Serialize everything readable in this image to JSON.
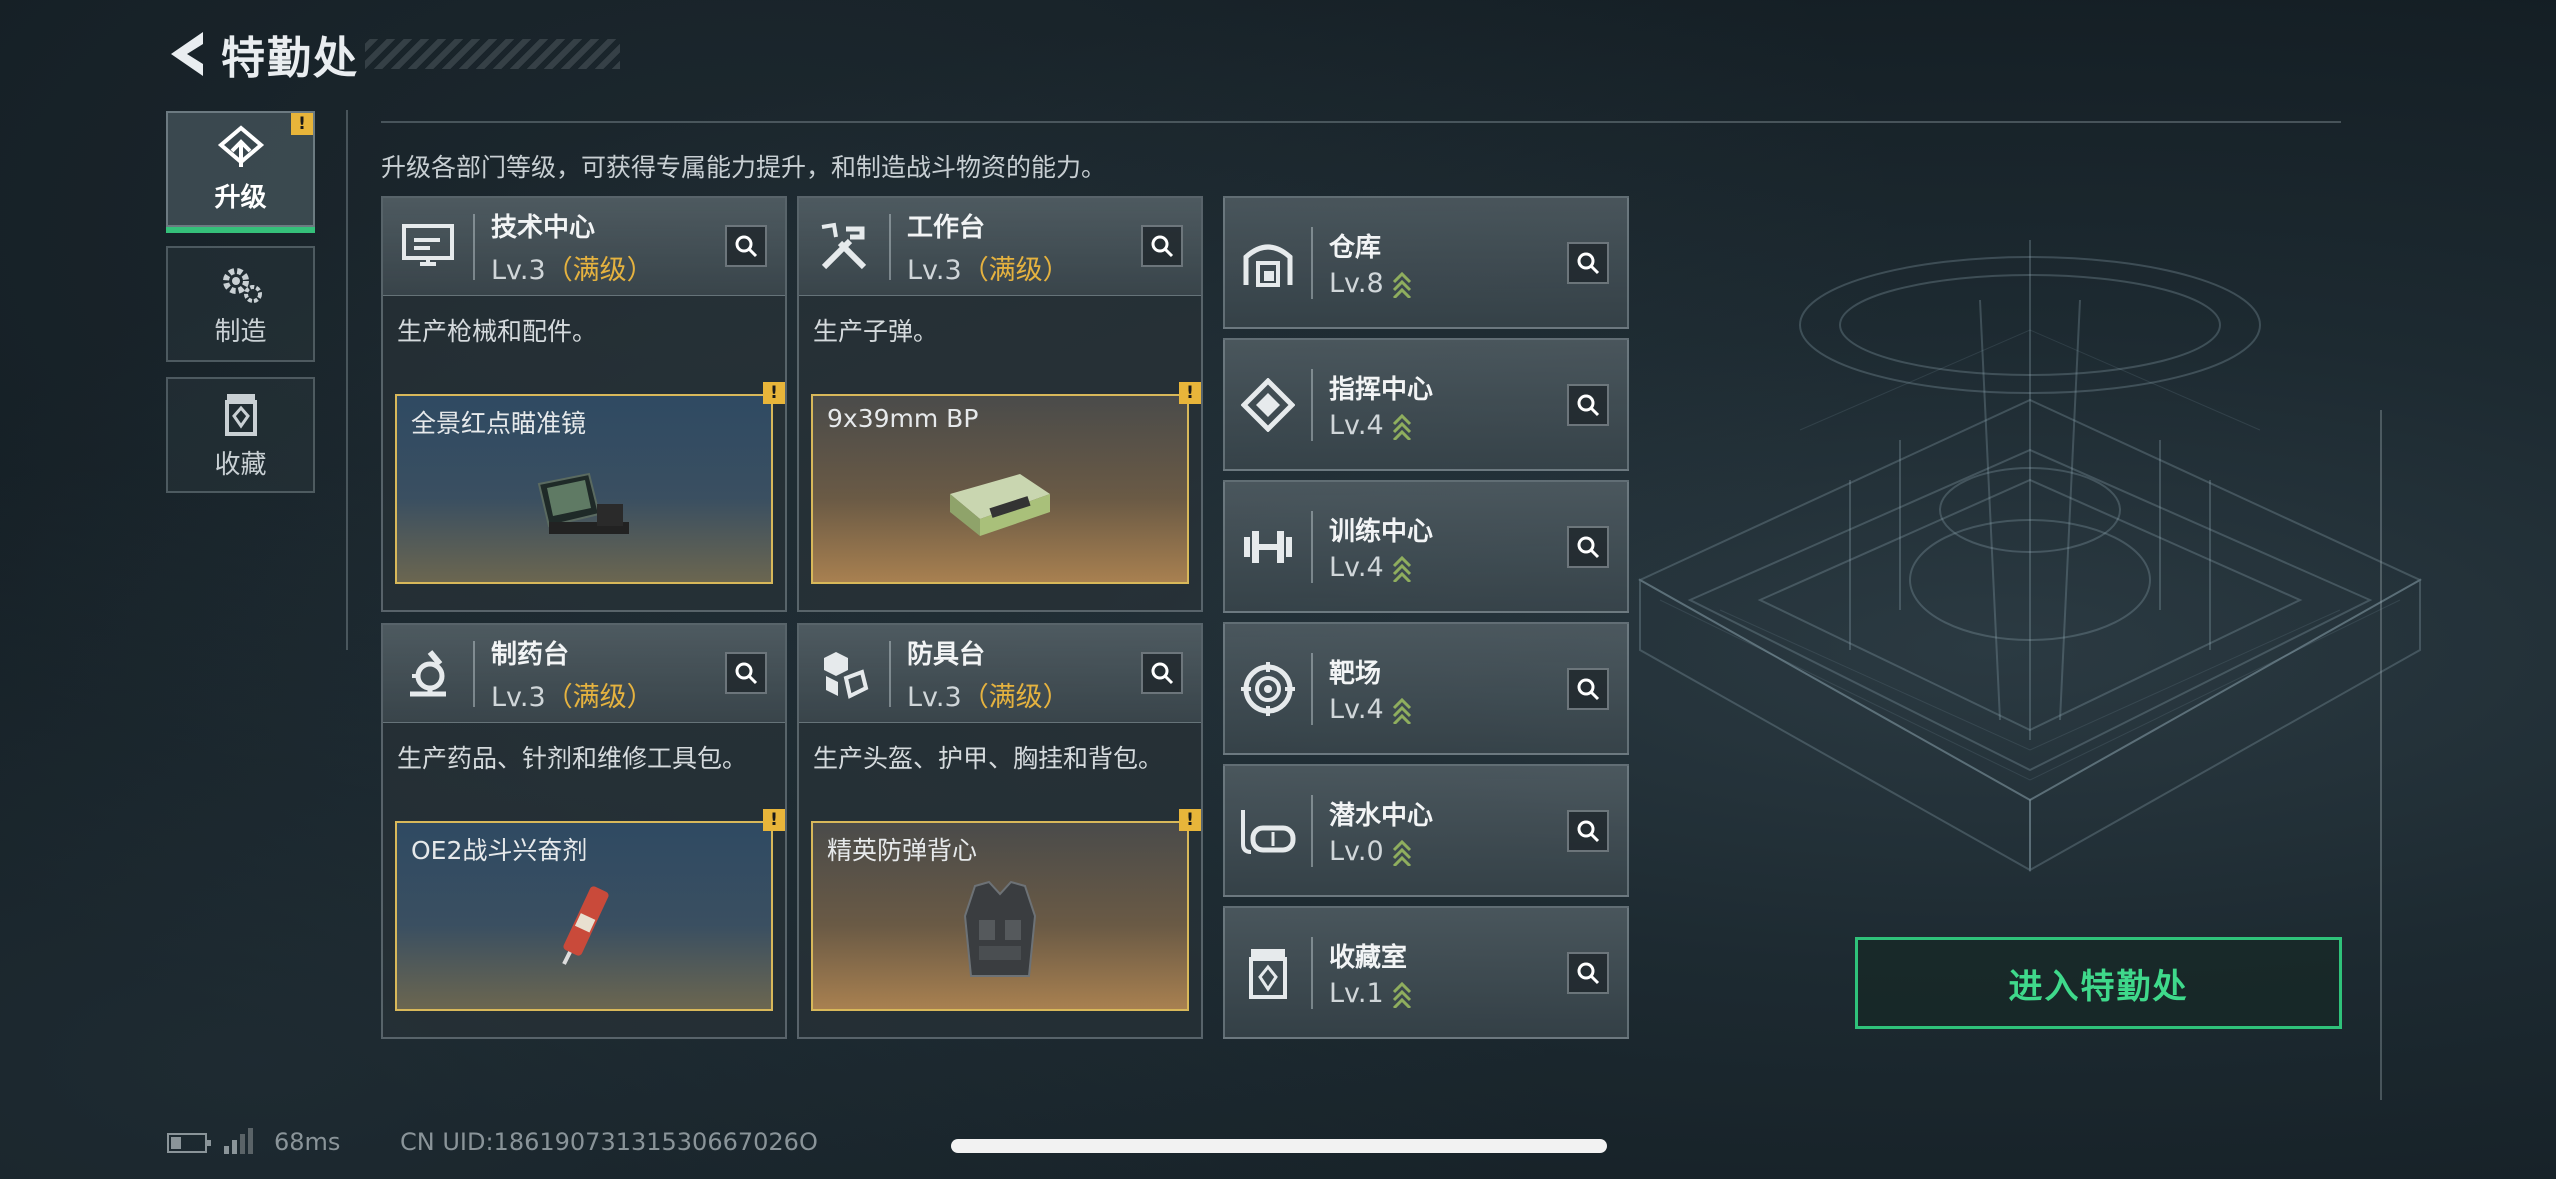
{
  "header": {
    "title": "特勤处"
  },
  "nav": [
    {
      "label": "升级",
      "icon": "upgrade-icon",
      "active": true,
      "warning": "!"
    },
    {
      "label": "制造",
      "icon": "gear-icon",
      "active": false
    },
    {
      "label": "收藏",
      "icon": "collection-icon",
      "active": false
    }
  ],
  "description": "升级各部门等级，可获得专属能力提升，和制造战斗物资的能力。",
  "cards": [
    {
      "name": "技术中心",
      "level": "Lv.3",
      "max": "（满级）",
      "desc": "生产枪械和配件。",
      "icon": "monitor-icon",
      "product": {
        "name": "全景红点瞄准镜",
        "warning": "!",
        "theme": "blue",
        "icon": "red-dot-sight-icon"
      }
    },
    {
      "name": "工作台",
      "level": "Lv.3",
      "max": "（满级）",
      "desc": "生产子弹。",
      "icon": "tools-icon",
      "product": {
        "name": "9x39mm BP",
        "warning": "!",
        "theme": "gold",
        "icon": "ammo-box-icon"
      }
    },
    {
      "name": "制药台",
      "level": "Lv.3",
      "max": "（满级）",
      "desc": "生产药品、针剂和维修工具包。",
      "icon": "microscope-icon",
      "product": {
        "name": "OE2战斗兴奋剂",
        "warning": "!",
        "theme": "blue",
        "icon": "injector-icon"
      }
    },
    {
      "name": "防具台",
      "level": "Lv.3",
      "max": "（满级）",
      "desc": "生产头盔、护甲、胸挂和背包。",
      "icon": "cubes-icon",
      "product": {
        "name": "精英防弹背心",
        "warning": "!",
        "theme": "gold",
        "icon": "armor-vest-icon"
      }
    }
  ],
  "facilities": [
    {
      "name": "仓库",
      "level": "Lv.8",
      "icon": "warehouse-icon"
    },
    {
      "name": "指挥中心",
      "level": "Lv.4",
      "icon": "command-icon"
    },
    {
      "name": "训练中心",
      "level": "Lv.4",
      "icon": "dumbbell-icon"
    },
    {
      "name": "靶场",
      "level": "Lv.4",
      "icon": "target-icon"
    },
    {
      "name": "潜水中心",
      "level": "Lv.0",
      "icon": "dive-mask-icon"
    },
    {
      "name": "收藏室",
      "level": "Lv.1",
      "icon": "collection-icon"
    }
  ],
  "enter_button": "进入特勤处",
  "status": {
    "ping": "68ms",
    "uid": "CN UID:18619073131530667026O"
  },
  "colors": {
    "accent_green": "#2fc27a",
    "max_level_gold": "#e5b23f",
    "warning": "#e8b53a"
  }
}
